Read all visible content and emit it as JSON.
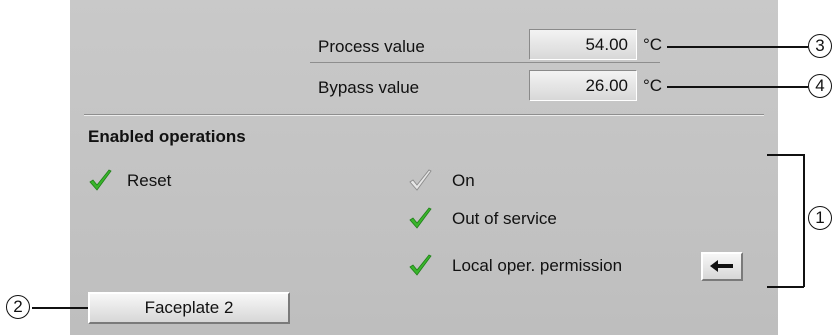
{
  "process": {
    "label": "Process value",
    "value": "54.00",
    "unit": "°C"
  },
  "bypass": {
    "label": "Bypass value",
    "value": "26.00",
    "unit": "°C"
  },
  "enabled": {
    "heading": "Enabled operations",
    "reset": "Reset",
    "on": "On",
    "out_of_service": "Out of service",
    "local_permission": "Local oper. permission"
  },
  "faceplate_button": "Faceplate 2",
  "callouts": {
    "c1": "1",
    "c2": "2",
    "c3": "3",
    "c4": "4"
  },
  "icons": {
    "check_enabled": "check-green-icon",
    "check_disabled": "check-grey-icon",
    "arrow": "arrow-left-icon"
  },
  "colors": {
    "panel": "#c4c4c4",
    "check_green": "#39b52b",
    "check_grey": "#b8b8b8"
  }
}
